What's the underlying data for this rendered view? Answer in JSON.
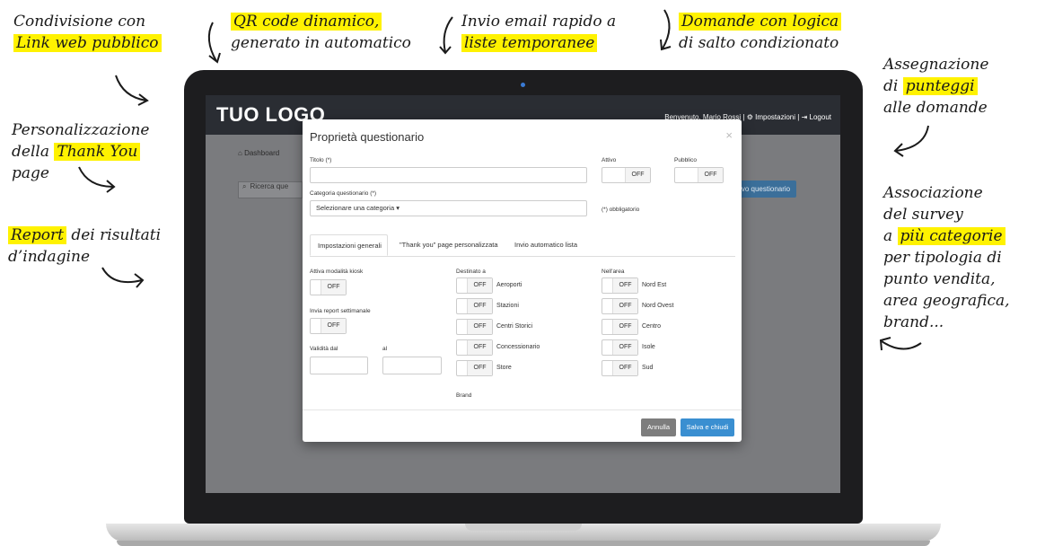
{
  "annotations": {
    "a1_line1": "Condivisione con",
    "a1_hl": "Link web pubblico",
    "a2_hl": "QR code dinamico,",
    "a2_line2": "generato in automatico",
    "a3_line1": "Invio email rapido a",
    "a3_hl": "liste temporanee",
    "a4_hl": "Domande con logica",
    "a4_line2": "di salto condizionato",
    "a5_line1": "Personalizzazione",
    "a5_pre": "della ",
    "a5_hl": "Thank You",
    "a5_line3": "page",
    "a6_hl": "Report",
    "a6_post": " dei risultati",
    "a6_line2": "d’indagine",
    "a7_line1": "Assegnazione",
    "a7_pre": "di ",
    "a7_hl": "punteggi",
    "a7_line3": "alle domande",
    "a8_line1": "Associazione",
    "a8_line2": "del survey",
    "a8_pre": "a ",
    "a8_hl": "più categorie",
    "a8_line4": "per tipologia di",
    "a8_line5": "punto vendita,",
    "a8_line6": "area geografica,",
    "a8_line7": "brand..."
  },
  "app": {
    "logo": "TUO LOGO",
    "welcome": "Benvenuto, Mario Rossi",
    "settings": "Impostazioni",
    "logout": "Logout",
    "sep": "|",
    "dashboard": "Dashboard",
    "search_placeholder": "Ricerca que",
    "new_button": "vo questionario"
  },
  "modal": {
    "title": "Proprietà questionario",
    "close": "×",
    "title_label": "Titolo (*)",
    "active_label": "Attivo",
    "public_label": "Pubblico",
    "category_label": "Categoria questionario (*)",
    "category_value": "Selezionare una categoria",
    "required_note": "(*) obbligatorio",
    "off": "OFF",
    "tabs": [
      "Impostazioni generali",
      "\"Thank you\" page personalizzata",
      "Invio automatico lista"
    ],
    "kiosk_label": "Attiva modalità kiosk",
    "weekly_label": "Invia report settimanale",
    "valid_from": "Validità dal",
    "valid_to": "al",
    "dest_label": "Destinato a",
    "dest_items": [
      "Aeroporti",
      "Stazioni",
      "Centri Storici",
      "Concessionario",
      "Store"
    ],
    "brand_label": "Brand",
    "area_label": "Nell'area",
    "area_items": [
      "Nord Est",
      "Nord Ovest",
      "Centro",
      "Isole",
      "Sud"
    ],
    "cancel": "Annulla",
    "save": "Salva e chiudi"
  },
  "colors": {
    "highlight": "#fff200",
    "primary_btn": "#3a8fd1",
    "cancel_btn": "#7d7d7d"
  }
}
